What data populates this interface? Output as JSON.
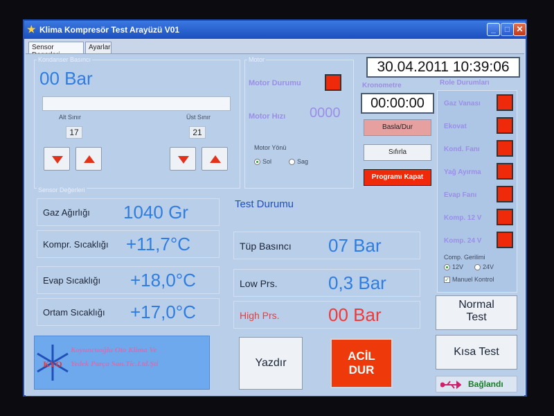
{
  "window": {
    "title": "Klima Kompresör Test Arayüzü V01",
    "controls": {
      "minimize": "_",
      "maximize": "□",
      "close": "✕"
    }
  },
  "tabs": [
    "Sensor Degerleri",
    "Ayarlar"
  ],
  "condenser": {
    "group_label": "Kondanser Basıncı",
    "value": "00 Bar",
    "progress_percent": 0,
    "min_label": "Alt Sınır",
    "max_label": "Üst Sınır",
    "min_value": "17",
    "max_value": "21"
  },
  "motor": {
    "group_label": "Motor",
    "status_label": "Motor Durumu",
    "speed_label": "Motor Hızı",
    "speed_value": "0000",
    "direction_label": "Motor Yönü",
    "direction_options": [
      "Sol",
      "Sag"
    ],
    "direction_selected": "Sol"
  },
  "datetime": "30.04.2011 10:39:06",
  "chronometer": {
    "label": "Kronometre",
    "value": "00:00:00",
    "start_stop": "Basla/Dur",
    "reset": "Sıfırla",
    "close_program": "Programı Kapat"
  },
  "relays": {
    "title": "Role Durumları",
    "items": [
      "Gaz Vanası",
      "Ekovat",
      "Kond. Fanı",
      "Yağ Ayırma",
      "Evap Fanı",
      "Komp. 12 V",
      "Komp. 24 V"
    ],
    "voltage_label": "Comp. Gerilimi",
    "voltage_options": [
      "12V",
      "24V"
    ],
    "voltage_selected": "12V",
    "manual_control": "Manuel Kontrol",
    "manual_checked": true
  },
  "sensors": {
    "group_label": "Sensor Değerleri",
    "items": [
      {
        "label": "Gaz Ağırlığı",
        "value": "1040 Gr"
      },
      {
        "label": "Kompr. Sıcaklığı",
        "value": "+11,7°C"
      },
      {
        "label": "Evap Sıcaklığı",
        "value": "+18,0°C"
      },
      {
        "label": "Ortam Sıcaklığı",
        "value": "+17,0°C"
      }
    ]
  },
  "test": {
    "title": "Test Durumu",
    "items": [
      {
        "label": "Tüp Basıncı",
        "value": "07 Bar"
      },
      {
        "label": "Low Prs.",
        "value": "0,3 Bar"
      },
      {
        "label": "High Prs.",
        "value": "00 Bar"
      }
    ]
  },
  "buttons": {
    "print": "Yazdır",
    "emergency_line1": "ACİL",
    "emergency_line2": "DUR",
    "normal_test_line1": "Normal",
    "normal_test_line2": "Test",
    "short_test": "Kısa Test"
  },
  "logo": {
    "initials": "KYO",
    "line1": "Koyuncuoğlu Oto Klima Ve",
    "line2": "Yedek Parça San.Tic.Ltd.Şti"
  },
  "connection": {
    "status": "Bağlandı"
  },
  "colors": {
    "accent_blue": "#2f7de0",
    "alarm_red": "#ee2a0a",
    "label_purple": "#9a8ee8",
    "high_pressure_red": "#ee3a3a",
    "connected_green": "#1a7a2a"
  }
}
